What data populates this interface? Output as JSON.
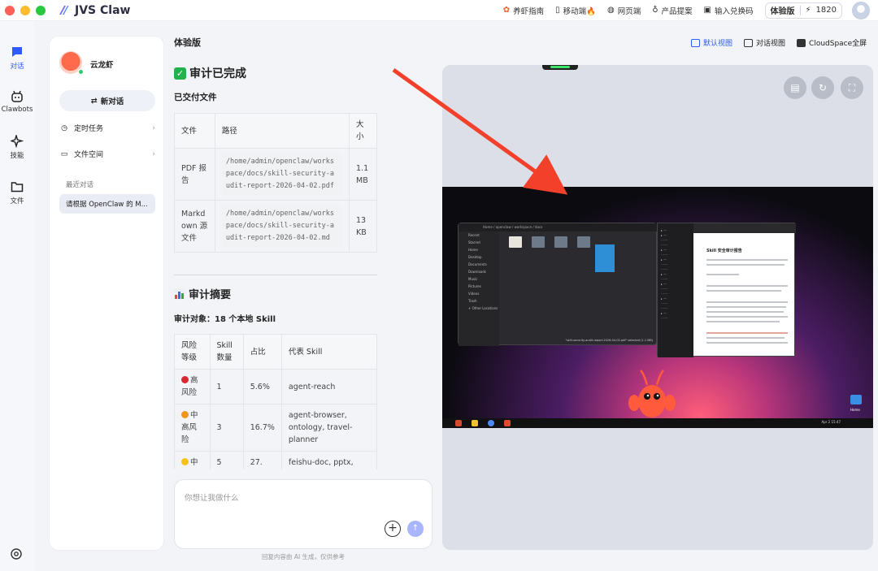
{
  "app": {
    "name": "JVS Claw"
  },
  "topbar": {
    "links": [
      {
        "icon": "shrimp-icon",
        "label": "养虾指南"
      },
      {
        "icon": "mobile-icon",
        "label": "移动端🔥"
      },
      {
        "icon": "globe-icon",
        "label": "网页端"
      },
      {
        "icon": "lightbulb-icon",
        "label": "产品提案"
      },
      {
        "icon": "ticket-icon",
        "label": "输入兑换码"
      }
    ],
    "tier": "体验版",
    "credits": "1820"
  },
  "rail": {
    "items": [
      {
        "label": "对话",
        "icon": "chat-icon",
        "active": true
      },
      {
        "label": "Clawbots",
        "icon": "bot-icon",
        "active": false
      },
      {
        "label": "技能",
        "icon": "sparkle-icon",
        "active": false
      },
      {
        "label": "文件",
        "icon": "folder-icon",
        "active": false
      }
    ]
  },
  "sidebar": {
    "bot_name": "云龙虾",
    "new_chat": "新对话",
    "scheduled": "定时任务",
    "file_space": "文件空间",
    "recent_label": "最近对话",
    "recent_item": "请根据 OpenClaw 的 M..."
  },
  "main": {
    "page_label": "体验版",
    "done_title": "审计已完成",
    "delivered_title": "已交付文件",
    "files_table": {
      "headers": [
        "文件",
        "路径",
        "大小"
      ],
      "rows": [
        [
          "PDF 报告",
          "/home/admin/openclaw/workspace/docs/skill-security-audit-report-2026-04-02.pdf",
          "1.1 MB"
        ],
        [
          "Markdown 源文件",
          "/home/admin/openclaw/workspace/docs/skill-security-audit-report-2026-04-02.md",
          "13 KB"
        ]
      ]
    },
    "summary_title": "审计摘要",
    "audit_target": "审计对象：18 个本地 Skill",
    "risk_table": {
      "headers": [
        "风险等级",
        "Skill 数量",
        "占比",
        "代表 Skill"
      ],
      "rows": [
        {
          "dot": "#d9282f",
          "level": "高风险",
          "count": "1",
          "ratio": "5.6%",
          "skills": "agent-reach"
        },
        {
          "dot": "#f0961e",
          "level": "中高风险",
          "count": "3",
          "ratio": "16.7%",
          "skills": "agent-browser, ontology, travel-planner"
        },
        {
          "dot": "#f6c21a",
          "level": "中",
          "count": "5",
          "ratio": "27.",
          "skills": "feishu-doc, pptx,"
        }
      ]
    }
  },
  "input": {
    "placeholder": "你想让我做什么",
    "footnote": "回复内容由 AI 生成，仅供参考"
  },
  "views": [
    {
      "label": "默认视图",
      "active": true
    },
    {
      "label": "对话视图",
      "active": false
    },
    {
      "label": "CloudSpace全屏",
      "active": false
    }
  ],
  "preview": {
    "fm_path": "Home / openclaw / workspace / docs",
    "fm_sidebar": [
      "Recent",
      "Starred",
      "Home",
      "Desktop",
      "Documents",
      "Downloads",
      "Music",
      "Pictures",
      "Videos",
      "Trash",
      "+ Other Locations"
    ],
    "fm_status": "\"skill-security-audit-report-2026-04-02.pdf\" selected (1.1 MB)",
    "doc_title": "Skill 安全审计报告",
    "home_label": "Home",
    "clock": "Apr 2  15:47"
  },
  "colors": {
    "accent": "#2e5bff",
    "arrow": "#f2402b",
    "online": "#2ecc71"
  }
}
